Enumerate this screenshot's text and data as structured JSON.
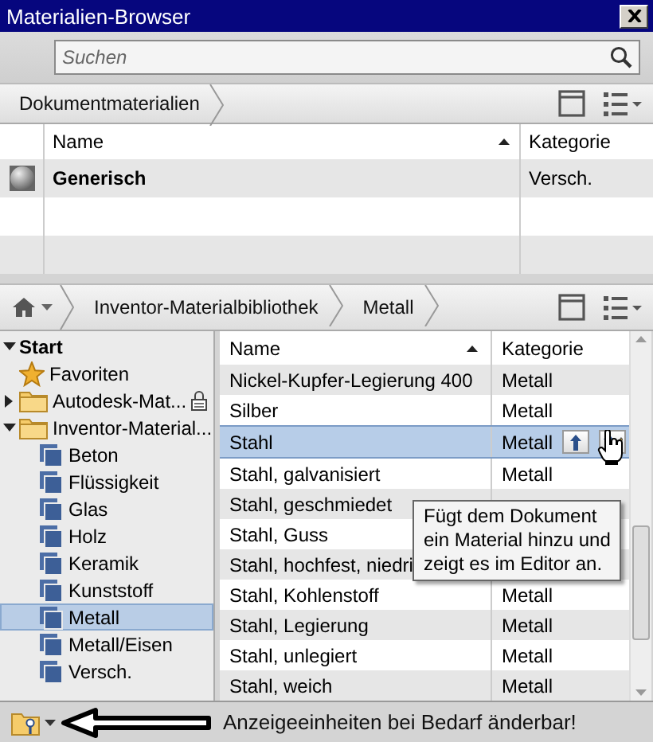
{
  "window": {
    "title": "Materialien-Browser"
  },
  "search": {
    "placeholder": "Suchen"
  },
  "document_materials": {
    "breadcrumb": [
      "Dokumentmaterialien"
    ],
    "columns": [
      "Name",
      "Kategorie"
    ],
    "rows": [
      {
        "name": "Generisch",
        "category": "Versch."
      }
    ]
  },
  "library": {
    "breadcrumb": [
      "Inventor-Materialbibliothek",
      "Metall"
    ],
    "tree": [
      {
        "label": "Start",
        "kind": "root",
        "expanded": true,
        "selected": false,
        "children": [
          {
            "label": "Favoriten",
            "kind": "favorites",
            "selected": false
          },
          {
            "label": "Autodesk-Mat...",
            "kind": "folder",
            "expanded": false,
            "locked": true,
            "selected": false
          },
          {
            "label": "Inventor-Material...",
            "kind": "folder",
            "expanded": true,
            "locked": false,
            "selected": false,
            "children": [
              {
                "label": "Beton",
                "kind": "category",
                "selected": false
              },
              {
                "label": "Flüssigkeit",
                "kind": "category",
                "selected": false
              },
              {
                "label": "Glas",
                "kind": "category",
                "selected": false
              },
              {
                "label": "Holz",
                "kind": "category",
                "selected": false
              },
              {
                "label": "Keramik",
                "kind": "category",
                "selected": false
              },
              {
                "label": "Kunststoff",
                "kind": "category",
                "selected": false
              },
              {
                "label": "Metall",
                "kind": "category",
                "selected": true
              },
              {
                "label": "Metall/Eisen",
                "kind": "category",
                "selected": false
              },
              {
                "label": "Versch.",
                "kind": "category",
                "selected": false
              }
            ]
          }
        ]
      }
    ],
    "columns": [
      "Name",
      "Kategorie"
    ],
    "rows": [
      {
        "name": "Nickel-Kupfer-Legierung 400",
        "category": "Metall",
        "selected": false,
        "actions": false
      },
      {
        "name": "Silber",
        "category": "Metall",
        "selected": false,
        "actions": false
      },
      {
        "name": "Stahl",
        "category": "Metall",
        "selected": true,
        "actions": true
      },
      {
        "name": "Stahl, galvanisiert",
        "category": "Metall",
        "selected": false,
        "actions": false
      },
      {
        "name": "Stahl, geschmiedet",
        "selected": false
      },
      {
        "name": "Stahl, Guss",
        "selected": false
      },
      {
        "name": "Stahl, hochfest, niedri",
        "selected": false
      },
      {
        "name": "Stahl, Kohlenstoff",
        "category": "Metall",
        "selected": false,
        "actions": false
      },
      {
        "name": "Stahl, Legierung",
        "category": "Metall",
        "selected": false,
        "actions": false
      },
      {
        "name": "Stahl, unlegiert",
        "category": "Metall",
        "selected": false,
        "actions": false
      },
      {
        "name": "Stahl, weich",
        "category": "Metall",
        "selected": false,
        "actions": false
      }
    ],
    "tooltip": {
      "lines": [
        "Fügt dem Dokument",
        "ein Material hinzu und",
        "zeigt es im Editor an."
      ]
    }
  },
  "status_bar": {
    "text": "Anzeigeeinheiten bei Bedarf änderbar!"
  }
}
